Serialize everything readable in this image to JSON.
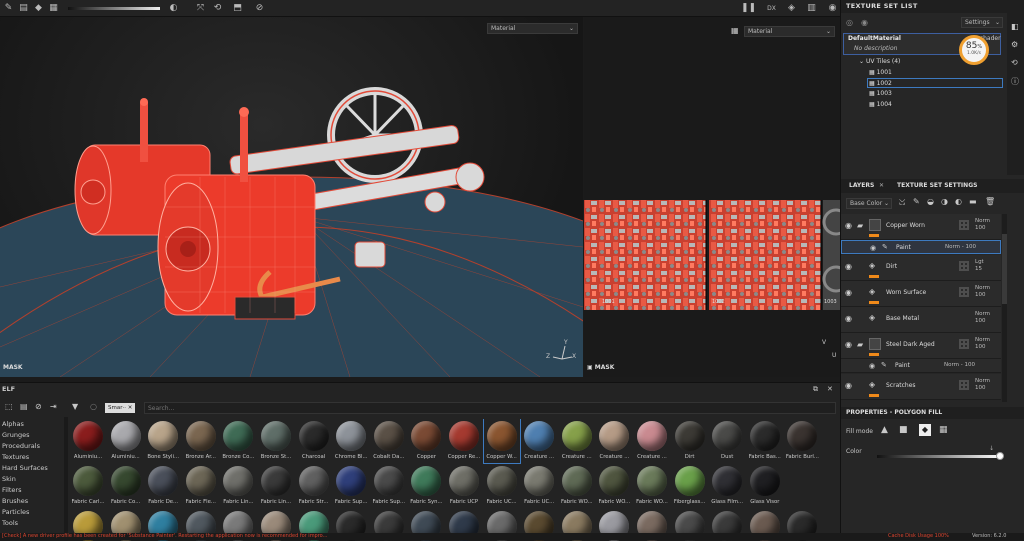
{
  "toolbar": {
    "right_labels": [
      "DX"
    ]
  },
  "viewport3d": {
    "material_select": "Material",
    "mode_label": "MASK",
    "axis_labels": [
      "Y",
      "Z",
      "X"
    ]
  },
  "viewport2d": {
    "material_select": "Material",
    "mode_label": "MASK",
    "axis_labels": [
      "V",
      "U"
    ],
    "uv_tiles": [
      "1001",
      "1002",
      "1003",
      "1004"
    ]
  },
  "texture_set_list": {
    "title": "TEXTURE SET LIST",
    "settings_label": "Settings",
    "material_name": "DefaultMaterial",
    "material_desc": "No description",
    "shader_label": "shader",
    "uv_tiles_label": "UV Tiles (4)",
    "tiles": [
      "1001",
      "1002",
      "1003",
      "1004"
    ],
    "perf": {
      "percent": "85",
      "rate": "1.0K/s"
    }
  },
  "layers_panel": {
    "tab_layers": "LAYERS",
    "tab_settings": "TEXTURE SET SETTINGS",
    "channel_select": "Base Color",
    "layers": [
      {
        "name": "Copper Worn",
        "blend": "Norm",
        "opacity": "100",
        "type": "folder"
      },
      {
        "name": "Paint",
        "blend": "Norm",
        "opacity": "100",
        "type": "paint-sub"
      },
      {
        "name": "Dirt",
        "blend": "Lgt",
        "opacity": "15",
        "type": "fill"
      },
      {
        "name": "Worn Surface",
        "blend": "Norm",
        "opacity": "100",
        "type": "fill"
      },
      {
        "name": "Base Metal",
        "blend": "Norm",
        "opacity": "100",
        "type": "fill"
      },
      {
        "name": "Steel Dark Aged",
        "blend": "Norm",
        "opacity": "100",
        "type": "folder"
      },
      {
        "name": "Paint",
        "blend": "Norm",
        "opacity": "100",
        "type": "paint-sub"
      },
      {
        "name": "Scratches",
        "blend": "Norm",
        "opacity": "100",
        "type": "fill"
      }
    ]
  },
  "properties": {
    "title": "PROPERTIES - POLYGON FILL",
    "fill_mode_label": "Fill mode",
    "color_label": "Color",
    "slider_value": 1.0
  },
  "shelf": {
    "title": "ELF",
    "filter_chip": "Smar··",
    "search_placeholder": "Search...",
    "categories": [
      "Alphas",
      "Grunges",
      "Procedurals",
      "Textures",
      "Hard Surfaces",
      "Skin",
      "Filters",
      "Brushes",
      "Particles",
      "Tools"
    ],
    "materials_row1": [
      {
        "label": "Aluminiu...",
        "color": "#8a1d1d"
      },
      {
        "label": "Aluminiu...",
        "color": "#a9a9ad"
      },
      {
        "label": "Bone Styli...",
        "color": "#b8a48a"
      },
      {
        "label": "Bronze Ar...",
        "color": "#7a6650"
      },
      {
        "label": "Bronze Co...",
        "color": "#3f6b55"
      },
      {
        "label": "Bronze St...",
        "color": "#5f6e68"
      },
      {
        "label": "Charcoal",
        "color": "#2a2a2a"
      },
      {
        "label": "Chrome Bl...",
        "color": "#8d9299"
      },
      {
        "label": "Cobalt Da...",
        "color": "#5a5046"
      },
      {
        "label": "Copper",
        "color": "#7a4a34"
      },
      {
        "label": "Copper Re...",
        "color": "#a53a30"
      },
      {
        "label": "Copper W...",
        "color": "#8a5530"
      },
      {
        "label": "Creature ...",
        "color": "#4f7fb0"
      },
      {
        "label": "Creature ...",
        "color": "#86a04a"
      },
      {
        "label": "Creature ...",
        "color": "#b59b86"
      },
      {
        "label": "Creature ...",
        "color": "#c98a90"
      },
      {
        "label": "Dirt",
        "color": "#3c3a35"
      },
      {
        "label": "Dust",
        "color": "#4a4a48"
      },
      {
        "label": "Fabric Bas...",
        "color": "#2b2b2b"
      },
      {
        "label": "Fabric Burl...",
        "color": "#3a3330"
      }
    ],
    "materials_row2": [
      {
        "label": "Fabric Carl...",
        "color": "#4c5a3c"
      },
      {
        "label": "Fabric Co...",
        "color": "#36482f"
      },
      {
        "label": "Fabric De...",
        "color": "#4a4f5a"
      },
      {
        "label": "Fabric Fle...",
        "color": "#6c6656"
      },
      {
        "label": "Fabric Lin...",
        "color": "#6f6f6a"
      },
      {
        "label": "Fabric Lin...",
        "color": "#3a3a3a"
      },
      {
        "label": "Fabric Str...",
        "color": "#606060"
      },
      {
        "label": "Fabric Sup...",
        "color": "#2f3f7a"
      },
      {
        "label": "Fabric Sup...",
        "color": "#4a4a4a"
      },
      {
        "label": "Fabric Syn...",
        "color": "#3f7a5a"
      },
      {
        "label": "Fabric UCP",
        "color": "#6e6e66"
      },
      {
        "label": "Fabric UC...",
        "color": "#5a5a50"
      },
      {
        "label": "Fabric UC...",
        "color": "#7a7a70"
      },
      {
        "label": "Fabric WO...",
        "color": "#5f6a55"
      },
      {
        "label": "Fabric WO...",
        "color": "#4f553f"
      },
      {
        "label": "Fabric WO...",
        "color": "#6a7a5a"
      },
      {
        "label": "Fiberglass...",
        "color": "#6aa04a"
      },
      {
        "label": "Glass Film...",
        "color": "#2f2f34"
      },
      {
        "label": "Glass Visor",
        "color": "#1f1f22"
      }
    ],
    "materials_row3": [
      {
        "color": "#b99b3a"
      },
      {
        "color": "#a09070"
      },
      {
        "color": "#2f7fa0"
      },
      {
        "color": "#50585f"
      },
      {
        "color": "#7a7a7a"
      },
      {
        "color": "#9a8a7a"
      },
      {
        "color": "#4a9a7a"
      },
      {
        "color": "#2a2a2a"
      },
      {
        "color": "#3a3a3a"
      },
      {
        "color": "#3f4a55"
      },
      {
        "color": "#2f3a4a"
      },
      {
        "color": "#6a6a6a"
      },
      {
        "color": "#5a4a30"
      },
      {
        "color": "#8a7a60"
      },
      {
        "color": "#9a9aa0"
      },
      {
        "color": "#7a6a60"
      },
      {
        "color": "#4a4a4a"
      },
      {
        "color": "#3a3a3a"
      },
      {
        "color": "#6a5a50"
      },
      {
        "color": "#2a2a2a"
      }
    ]
  },
  "status": {
    "message": "[Check] A new driver profile has been created for 'Substance Painter'. Restarting the application now is recommended for impro...",
    "cache": "Cache Disk Usage  100%",
    "version": "Version: 6.2.0"
  }
}
